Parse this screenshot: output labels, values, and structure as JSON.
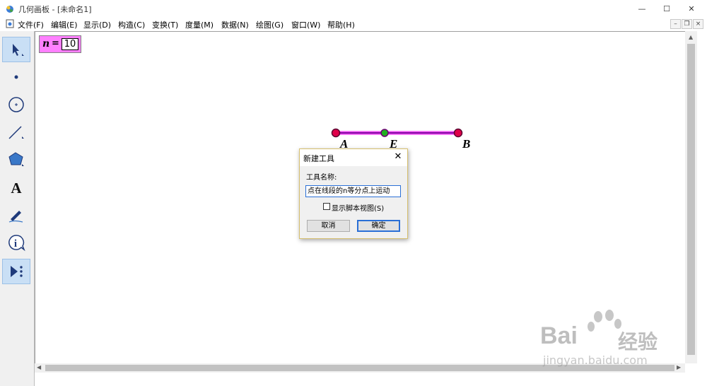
{
  "window": {
    "title": "几何画板 - [未命名1]",
    "controls": {
      "minimize": "—",
      "maximize": "☐",
      "close": "✕"
    }
  },
  "menu": {
    "items": [
      "文件(F)",
      "编辑(E)",
      "显示(D)",
      "构造(C)",
      "变换(T)",
      "度量(M)",
      "数据(N)",
      "绘图(G)",
      "窗口(W)",
      "帮助(H)"
    ],
    "mdi": {
      "minimize": "–",
      "restore": "❐",
      "close": "×"
    }
  },
  "toolbox": {
    "tools": [
      "arrow-select",
      "point",
      "compass",
      "straightedge",
      "polygon",
      "text",
      "marker",
      "information",
      "custom-tools"
    ],
    "selected": "arrow-select"
  },
  "canvas": {
    "parameter": {
      "name": "n",
      "equals": "=",
      "value": "10"
    },
    "points": [
      "A",
      "E",
      "B"
    ],
    "colors": {
      "segment": "#8b00a8",
      "endpoint": "#e0004a",
      "midpoint": "#20b020",
      "parameter_bg": "#ff80ff"
    }
  },
  "dialog": {
    "title": "新建工具",
    "close": "✕",
    "name_label": "工具名称:",
    "name_value": "点在线段的n等分点上运动",
    "checkbox_label": "显示脚本视图(S)",
    "checkbox_checked": false,
    "cancel": "取消",
    "ok": "确定"
  },
  "watermark": {
    "brand": "Bai",
    "brand2": "du",
    "product": "经验",
    "url": "jingyan.baidu.com"
  }
}
